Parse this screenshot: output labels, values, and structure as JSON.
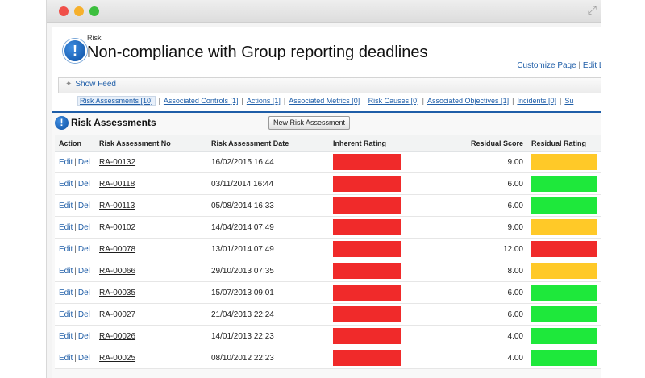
{
  "colors": {
    "red": "#f02a2a",
    "amber": "#ffc928",
    "green": "#1ee83b",
    "link": "#1f5ea8"
  },
  "header": {
    "breadcrumb": "Risk",
    "title": "Non-compliance with Group reporting deadlines",
    "customize_page": "Customize Page",
    "edit_layout": "Edit La",
    "show_feed": "Show Feed"
  },
  "tabs": [
    {
      "label": "Risk Assessments",
      "count": "[10]"
    },
    {
      "label": "Associated Controls",
      "count": "[1]"
    },
    {
      "label": "Actions",
      "count": "[1]"
    },
    {
      "label": "Associated Metrics",
      "count": "[0]"
    },
    {
      "label": "Risk Causes",
      "count": "[0]"
    },
    {
      "label": "Associated Objectives",
      "count": "[1]"
    },
    {
      "label": "Incidents",
      "count": "[0]"
    },
    {
      "label": "Su",
      "count": ""
    }
  ],
  "section": {
    "title": "Risk Assessments",
    "new_button": "New Risk Assessment",
    "columns": [
      "Action",
      "Risk Assessment No",
      "Risk Assessment Date",
      "Inherent Rating",
      "Residual Score",
      "Residual Rating"
    ],
    "edit_label": "Edit",
    "del_label": "Del",
    "rows": [
      {
        "no": "RA-00132",
        "date": "16/02/2015 16:44",
        "inherent": "red",
        "score": "9.00",
        "residual": "amber"
      },
      {
        "no": "RA-00118",
        "date": "03/11/2014 16:44",
        "inherent": "red",
        "score": "6.00",
        "residual": "green"
      },
      {
        "no": "RA-00113",
        "date": "05/08/2014 16:33",
        "inherent": "red",
        "score": "6.00",
        "residual": "green"
      },
      {
        "no": "RA-00102",
        "date": "14/04/2014 07:49",
        "inherent": "red",
        "score": "9.00",
        "residual": "amber"
      },
      {
        "no": "RA-00078",
        "date": "13/01/2014 07:49",
        "inherent": "red",
        "score": "12.00",
        "residual": "red"
      },
      {
        "no": "RA-00066",
        "date": "29/10/2013 07:35",
        "inherent": "red",
        "score": "8.00",
        "residual": "amber"
      },
      {
        "no": "RA-00035",
        "date": "15/07/2013 09:01",
        "inherent": "red",
        "score": "6.00",
        "residual": "green"
      },
      {
        "no": "RA-00027",
        "date": "21/04/2013 22:24",
        "inherent": "red",
        "score": "6.00",
        "residual": "green"
      },
      {
        "no": "RA-00026",
        "date": "14/01/2013 22:23",
        "inherent": "red",
        "score": "4.00",
        "residual": "green"
      },
      {
        "no": "RA-00025",
        "date": "08/10/2012 22:23",
        "inherent": "red",
        "score": "4.00",
        "residual": "green"
      }
    ]
  }
}
